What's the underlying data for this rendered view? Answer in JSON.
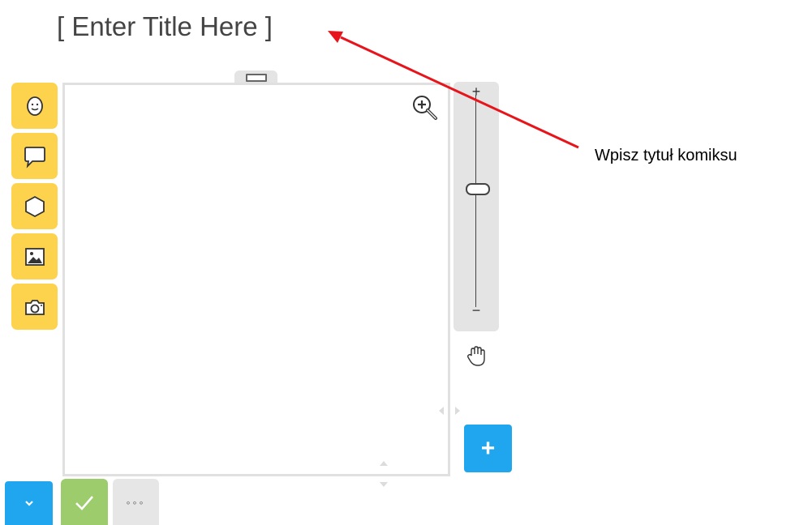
{
  "header": {
    "title": "[ Enter Title Here ]"
  },
  "toolbar": {
    "items": [
      {
        "name": "character",
        "icon": "smiley-face-icon"
      },
      {
        "name": "speech-bubble",
        "icon": "speech-bubble-icon"
      },
      {
        "name": "shape",
        "icon": "hexagon-icon"
      },
      {
        "name": "image",
        "icon": "picture-icon"
      },
      {
        "name": "camera",
        "icon": "camera-icon"
      }
    ]
  },
  "zoom": {
    "plus": "+",
    "minus": "−"
  },
  "buttons": {
    "add_label": "+",
    "more_label": "◦◦◦"
  },
  "annotation": {
    "label": "Wpisz tytuł komiksu"
  },
  "colors": {
    "tool_yellow": "#fdd24d",
    "action_blue": "#20a6ee",
    "confirm_green": "#9ccc6b",
    "annotation_arrow": "#e8141b"
  }
}
